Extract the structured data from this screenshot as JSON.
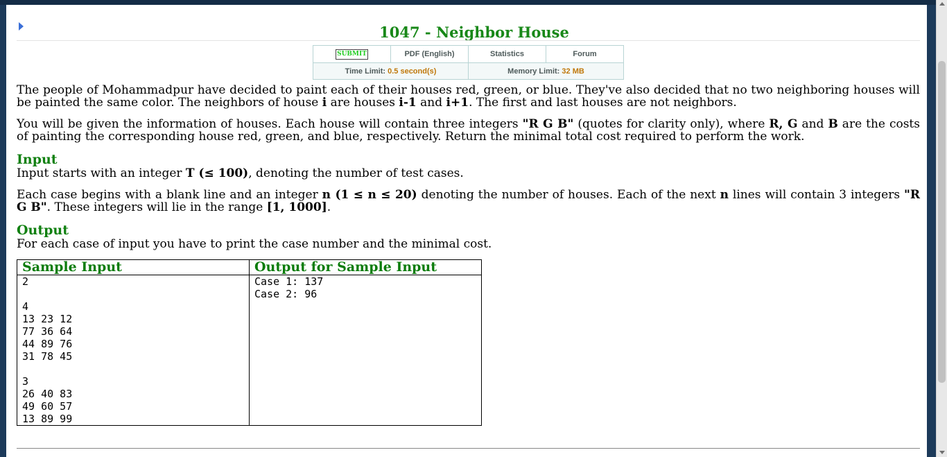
{
  "problem": {
    "title": "1047 - Neighbor House"
  },
  "links": {
    "submit": "SUBMIT",
    "pdf": "PDF (English)",
    "statistics": "Statistics",
    "forum": "Forum"
  },
  "limits": {
    "time_label": "Time Limit:",
    "time_value": "0.5 second(s)",
    "memory_label": "Memory Limit:",
    "memory_value": "32 MB"
  },
  "statement": {
    "p1_a": "The people of Mohammadpur have decided to paint each of their houses red, green, or blue. They've also decided that no two neighboring houses will be painted the same color. The neighbors of house ",
    "p1_b": "i",
    "p1_c": " are houses ",
    "p1_d": "i-1",
    "p1_e": " and ",
    "p1_f": "i+1",
    "p1_g": ". The first and last houses are not neighbors.",
    "p2_a": "You will be given the information of houses. Each house will contain three integers ",
    "p2_b": "\"R G B\"",
    "p2_c": " (quotes for clarity only), where ",
    "p2_d": "R, G",
    "p2_e": " and ",
    "p2_f": "B",
    "p2_g": " are the costs of painting the corresponding house red, green, and blue, respectively. Return the minimal total cost required to perform the work."
  },
  "input": {
    "heading": "Input",
    "p1_a": "Input starts with an integer ",
    "p1_b": "T (≤ 100)",
    "p1_c": ", denoting the number of test cases.",
    "p2_a": "Each case begins with a blank line and an integer ",
    "p2_b": "n (1 ≤ n ≤ 20)",
    "p2_c": " denoting the number of houses. Each of the next ",
    "p2_d": "n",
    "p2_e": " lines will contain 3 integers ",
    "p2_f": "\"R G B\"",
    "p2_g": ". These integers will lie in the range ",
    "p2_h": "[1, 1000]",
    "p2_i": "."
  },
  "output": {
    "heading": "Output",
    "p1": "For each case of input you have to print the case number and the minimal cost."
  },
  "samples": {
    "input_heading": "Sample Input",
    "output_heading": "Output for Sample Input",
    "input_text": "2\n\n4\n13 23 12\n77 36 64\n44 89 76\n31 78 45\n\n3\n26 40 83\n49 60 57\n13 89 99",
    "output_text": "Case 1: 137\nCase 2: 96"
  }
}
